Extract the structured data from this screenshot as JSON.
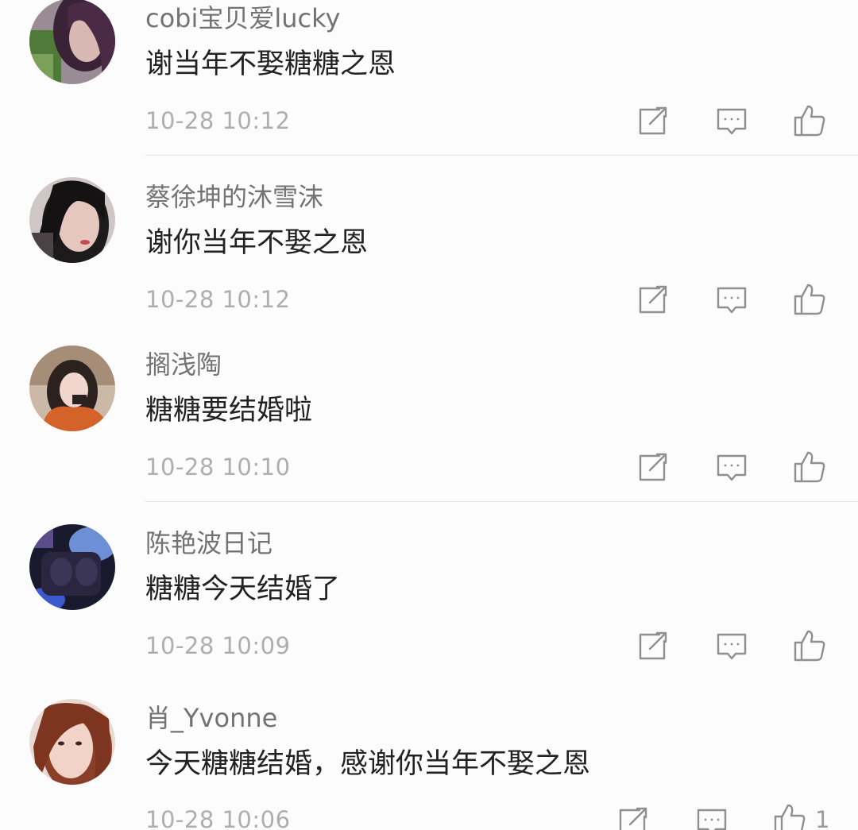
{
  "comments": [
    {
      "username": "cobi宝贝爱lucky",
      "text": "谢当年不娶糖糖之恩",
      "time": "10-28 10:12"
    },
    {
      "username": "蔡徐坤的沐雪沫",
      "text": "谢你当年不娶之恩",
      "time": "10-28 10:12"
    },
    {
      "username": "搁浅陶",
      "text": "糖糖要结婚啦",
      "time": "10-28 10:10"
    },
    {
      "username": "陈艳波日记",
      "text": "糖糖今天结婚了",
      "time": "10-28 10:09"
    },
    {
      "username": "肖_Yvonne",
      "text": "今天糖糖结婚，感谢你当年不娶之恩",
      "time": "10-28 10:06",
      "like_count": "1"
    }
  ],
  "icons": {
    "share": "share-icon",
    "reply": "reply-comment-icon",
    "like": "thumbs-up-icon"
  },
  "colors": {
    "background": "#fdfcfd",
    "username": "#737373",
    "text": "#222222",
    "timestamp": "#aeaeae",
    "icon": "#8f8f8f"
  }
}
